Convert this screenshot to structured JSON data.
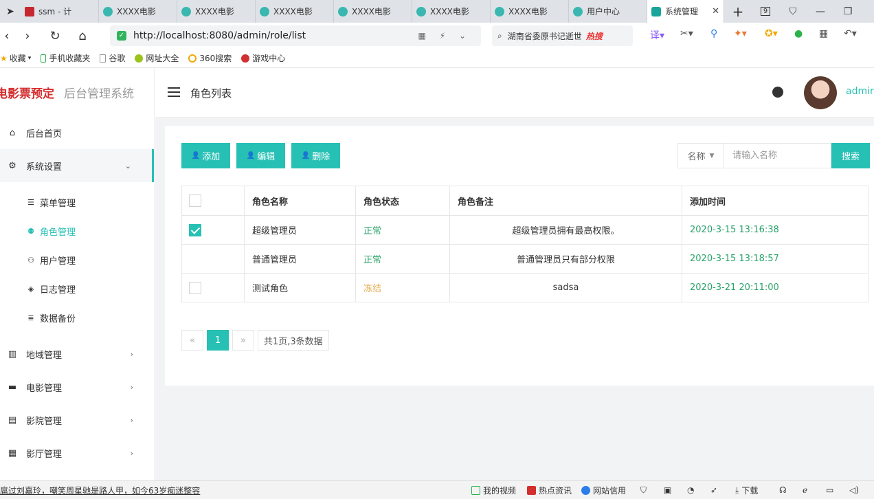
{
  "browser": {
    "tabs": [
      {
        "label": "ssm - 计",
        "icon": "red"
      },
      {
        "label": "XXXX电影",
        "icon": "teal"
      },
      {
        "label": "XXXX电影",
        "icon": "teal"
      },
      {
        "label": "XXXX电影",
        "icon": "teal"
      },
      {
        "label": "XXXX电影",
        "icon": "teal"
      },
      {
        "label": "XXXX电影",
        "icon": "teal"
      },
      {
        "label": "XXXX电影",
        "icon": "teal"
      },
      {
        "label": "用户中心",
        "icon": "teal"
      },
      {
        "label": "系统管理",
        "icon": "green",
        "active": true
      }
    ],
    "new_tab": "+",
    "tab_count": "9",
    "url": "http://localhost:8080/admin/role/list",
    "search_text": "湖南省委原书记逝世",
    "search_hot": "热搜",
    "bookmarks": [
      "收藏",
      "手机收藏夹",
      "谷歌",
      "网址大全",
      "360搜索",
      "游戏中心"
    ]
  },
  "app": {
    "brand_main": "电影票预定",
    "brand_sub": "后台管理系统",
    "page_title": "角色列表",
    "username": "admin",
    "menu": [
      {
        "label": "后台首页",
        "icon": "home"
      },
      {
        "label": "系统设置",
        "icon": "gear"
      }
    ],
    "submenu": [
      {
        "label": "菜单管理"
      },
      {
        "label": "角色管理"
      },
      {
        "label": "用户管理"
      },
      {
        "label": "日志管理"
      },
      {
        "label": "数据备份"
      }
    ],
    "menu_bottom": [
      {
        "label": "地域管理"
      },
      {
        "label": "电影管理"
      },
      {
        "label": "影院管理"
      },
      {
        "label": "影厅管理"
      }
    ]
  },
  "toolbar": {
    "add_label": "添加",
    "edit_label": "编辑",
    "delete_label": "删除",
    "filter_field": "名称",
    "search_placeholder": "请输入名称",
    "search_label": "搜索"
  },
  "table": {
    "columns": [
      "角色名称",
      "角色状态",
      "角色备注",
      "添加时间"
    ],
    "rows": [
      {
        "name": "超级管理员",
        "status": "正常",
        "remark": "超级管理员拥有最高权限。",
        "time": "2020-3-15 13:16:38",
        "checked": true
      },
      {
        "name": "普通管理员",
        "status": "正常",
        "remark": "普通管理员只有部分权限",
        "time": "2020-3-15 13:18:57",
        "checked": false
      },
      {
        "name": "测试角色",
        "status": "冻结",
        "remark": "sadsa",
        "time": "2020-3-21 20:11:00",
        "checked": false
      }
    ]
  },
  "pagination": {
    "prev": "«",
    "current": "1",
    "next": "»",
    "info": "共1页,3条数据"
  },
  "statusbar": {
    "news": "扈过刘嘉玲，嘲笑周星驰是路人甲，如今63岁痴迷整容",
    "my_video": "我的视频",
    "hot_news": "热点资讯",
    "site_credit": "网站信用",
    "download": "下载"
  }
}
